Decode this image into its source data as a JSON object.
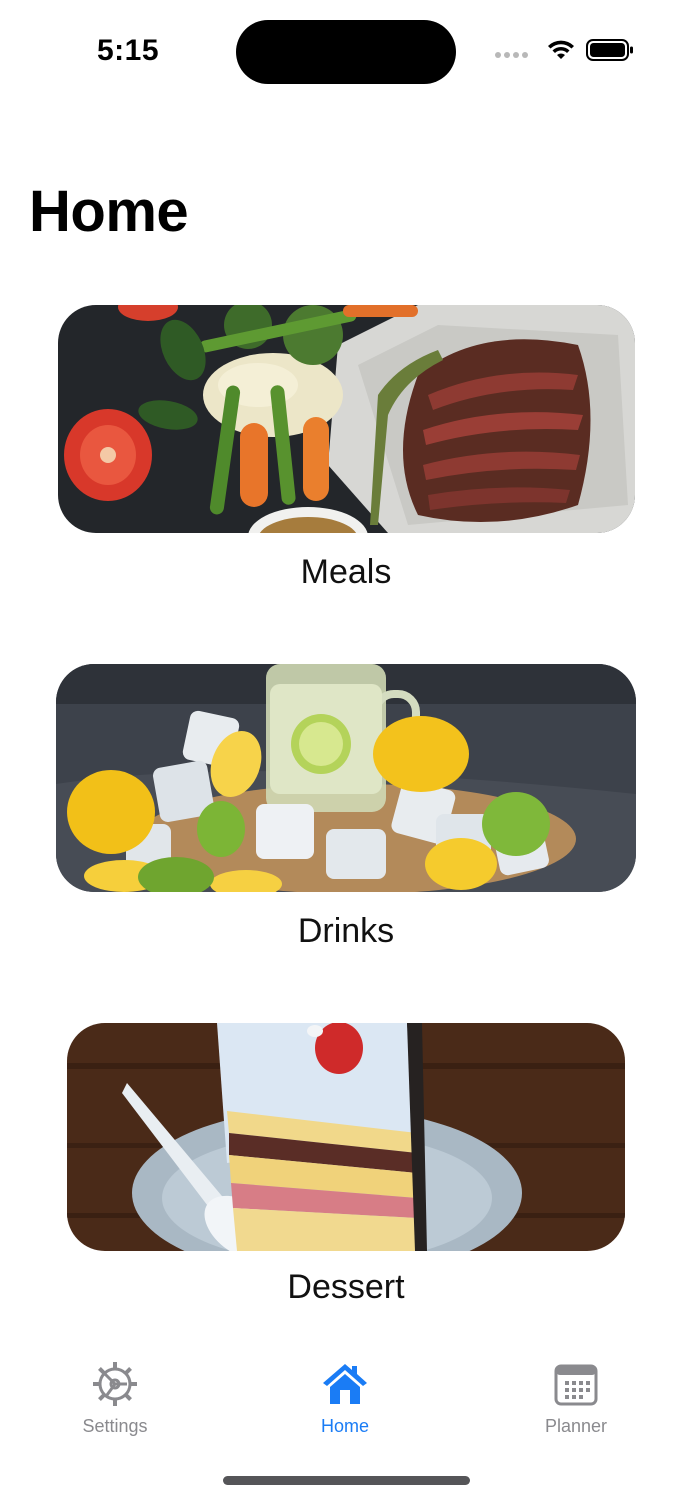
{
  "status_bar": {
    "time": "5:15"
  },
  "page": {
    "title": "Home"
  },
  "categories": [
    {
      "label": "Meals",
      "image": "meals-photo"
    },
    {
      "label": "Drinks",
      "image": "drinks-photo"
    },
    {
      "label": "Dessert",
      "image": "dessert-photo"
    }
  ],
  "tab_bar": {
    "tabs": [
      {
        "label": "Settings",
        "icon": "gear-icon",
        "selected": false
      },
      {
        "label": "Home",
        "icon": "house-icon",
        "selected": true
      },
      {
        "label": "Planner",
        "icon": "calendar-icon",
        "selected": false
      }
    ]
  },
  "colors": {
    "accent": "#1a7cf5",
    "inactive_tab": "#8a8a8e"
  }
}
